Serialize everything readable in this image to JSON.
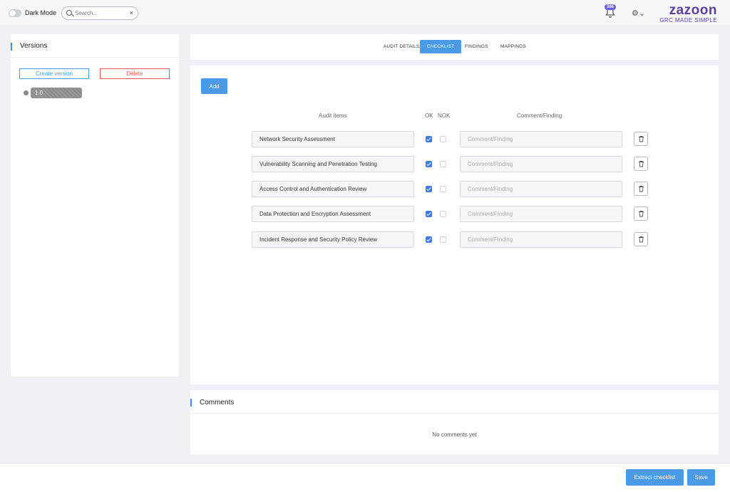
{
  "header": {
    "dark_mode_label": "Dark Mode",
    "search_placeholder": "Search...",
    "clear_icon": "×",
    "notification_count": "386",
    "brand": "zazoon",
    "tagline": "GRC MADE SIMPLE"
  },
  "sidebar": {
    "title": "Versions",
    "create_label": "Create version",
    "delete_label": "Delete",
    "versions": [
      "1.0"
    ]
  },
  "tabs": [
    {
      "label": "AUDIT DETAILS",
      "active": false
    },
    {
      "label": "CHECKLIST",
      "active": true
    },
    {
      "label": "FINDINGS",
      "active": false
    },
    {
      "label": "MAPPINGS",
      "active": false
    }
  ],
  "checklist": {
    "add_label": "Add",
    "columns": {
      "items": "Audit items",
      "ok": "OK",
      "nok": "NOK",
      "comment": "Comment/Finding"
    },
    "comment_placeholder": "Comment/Finding",
    "rows": [
      {
        "item": "Network Security Assessment",
        "ok": true,
        "nok": false
      },
      {
        "item": "Vulnerability Scanning and Penetration Testing",
        "ok": true,
        "nok": false
      },
      {
        "item": "Access Control and Authentication Review",
        "ok": true,
        "nok": false
      },
      {
        "item": "Data Protection and Encryption Assessment",
        "ok": true,
        "nok": false
      },
      {
        "item": "Incident Response and Security Policy Review",
        "ok": true,
        "nok": false
      }
    ]
  },
  "comments": {
    "title": "Comments",
    "empty_text": "No comments yet"
  },
  "footer": {
    "extract_label": "Extract checklist",
    "save_label": "Save"
  },
  "colors": {
    "accent": "#4a9ae8",
    "danger": "#e25858",
    "brand": "#5b3fa0"
  }
}
